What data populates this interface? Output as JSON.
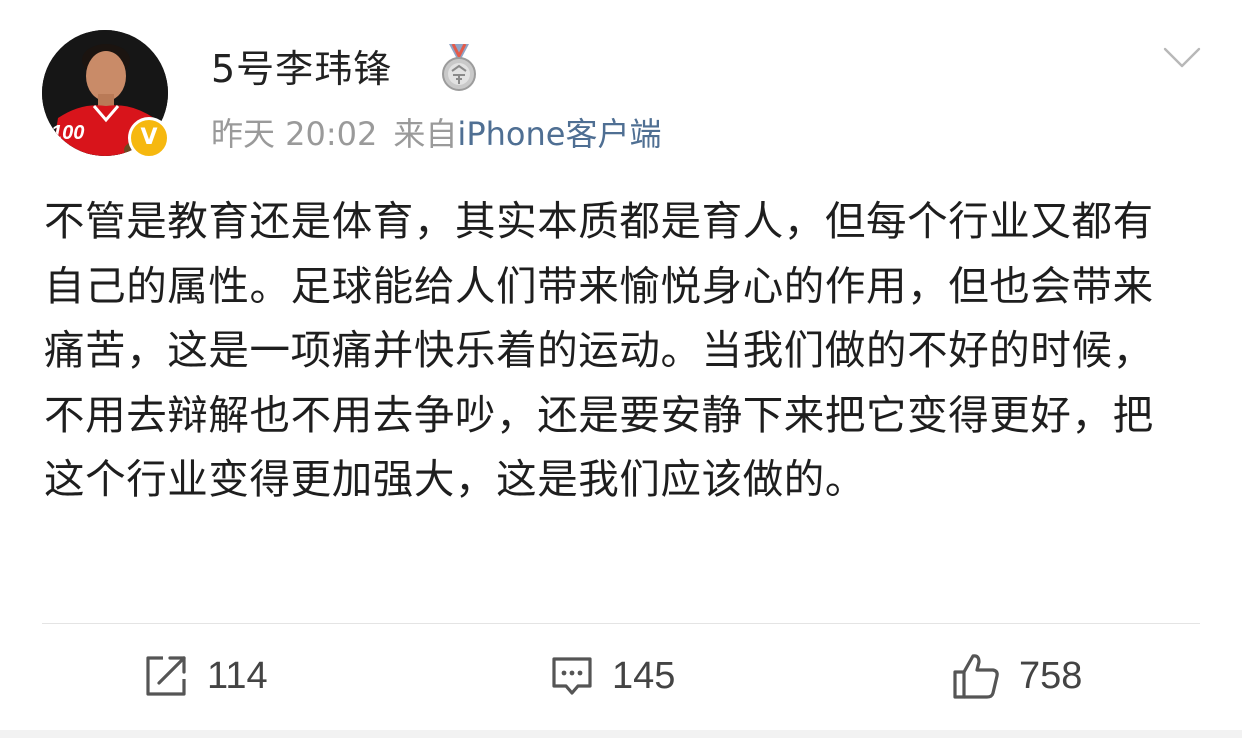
{
  "post": {
    "author": {
      "name": "5号李玮锋",
      "avatar_icon": "player-avatar",
      "verified_badge": "V",
      "medal_icon": "medal-icon",
      "avatar_jersey_number": "100"
    },
    "meta": {
      "time": "昨天 20:02",
      "source_prefix": "来自",
      "client": "iPhone客户端"
    },
    "content": "不管是教育还是体育，其实本质都是育人，但每个行业又都有自己的属性。足球能给人们带来愉悦身心的作用，但也会带来痛苦，这是一项痛并快乐着的运动。当我们做的不好的时候，不用去辩解也不用去争吵，还是要安静下来把它变得更好，把这个行业变得更加强大，这是我们应该做的。",
    "actions": {
      "repost_count": "114",
      "comment_count": "145",
      "like_count": "758"
    }
  },
  "colors": {
    "text": "#1e1e1e",
    "meta_gray": "#9a9a9a",
    "client_link": "#4f6f93",
    "verified_gold": "#f6b80f",
    "icon_gray": "#555555"
  }
}
